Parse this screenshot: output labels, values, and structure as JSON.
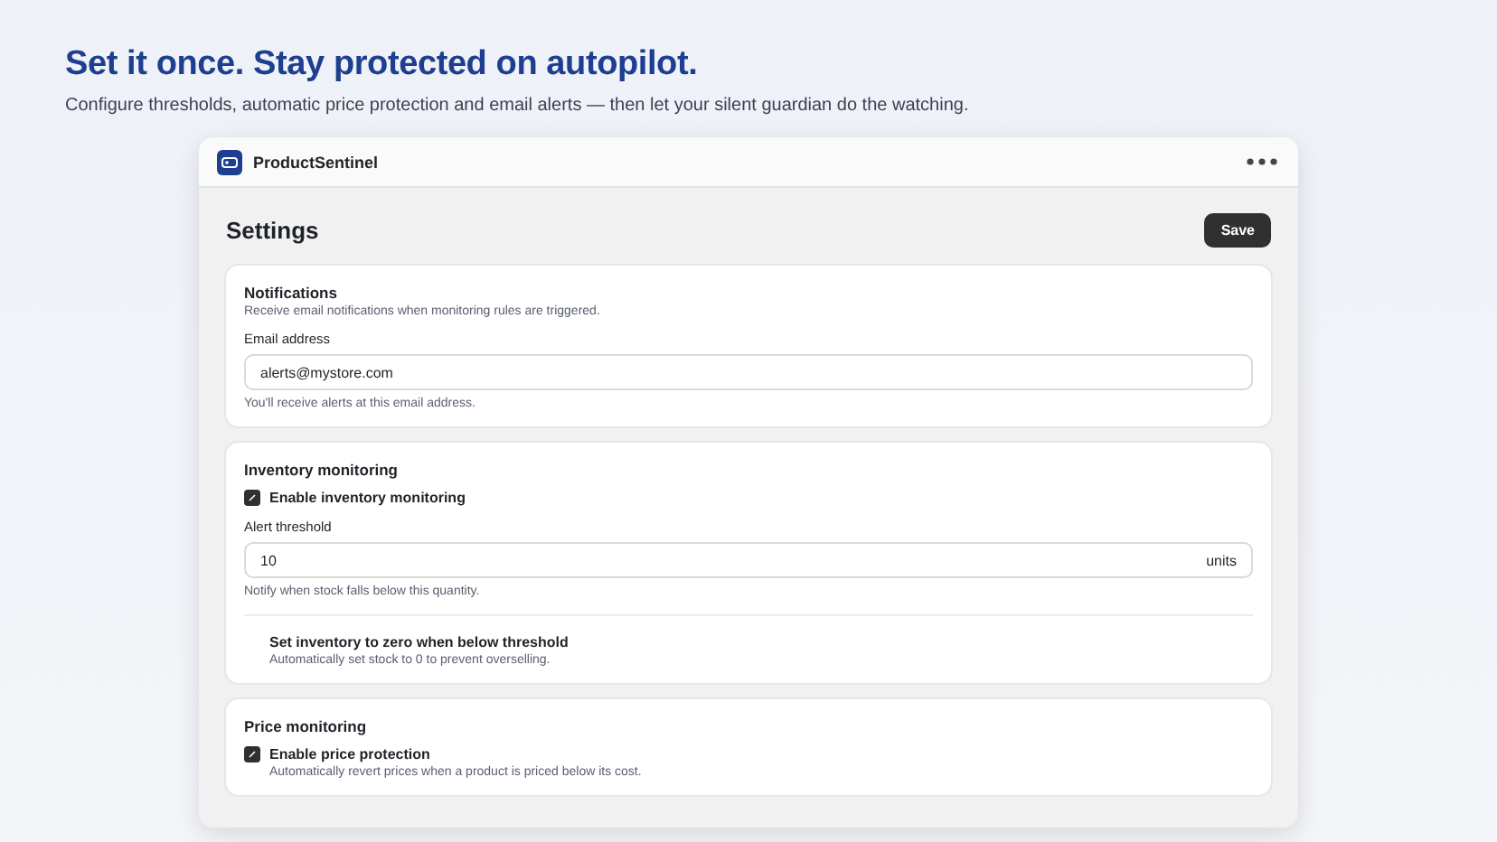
{
  "headline": "Set it once. Stay protected on autopilot.",
  "subtitle": "Configure thresholds, automatic price protection and email alerts — then let your silent guardian do the watching.",
  "window": {
    "title": "ProductSentinel"
  },
  "page": {
    "title": "Settings",
    "save_button": "Save"
  },
  "sections": [
    {
      "title": "Notifications",
      "description": "Receive email notifications when monitoring rules are triggered.",
      "items": [
        {
          "kind": "field",
          "label": "Email address",
          "value": "alerts@mystore.com",
          "help": "You'll receive alerts at this email address."
        }
      ]
    },
    {
      "title": "Inventory monitoring",
      "items": [
        {
          "kind": "checkbox",
          "label": "Enable inventory monitoring",
          "checked": true
        },
        {
          "kind": "field",
          "label": "Alert threshold",
          "value": "10",
          "suffix": "units",
          "help": "Notify when stock falls below this quantity."
        },
        {
          "kind": "option",
          "label": "Set inventory to zero when below threshold",
          "help": "Automatically set stock to 0 to prevent overselling."
        }
      ]
    },
    {
      "title": "Price monitoring",
      "items": [
        {
          "kind": "checkbox",
          "label": "Enable price protection",
          "checked": true,
          "help": "Automatically revert prices when a product is priced below its cost."
        }
      ]
    }
  ]
}
